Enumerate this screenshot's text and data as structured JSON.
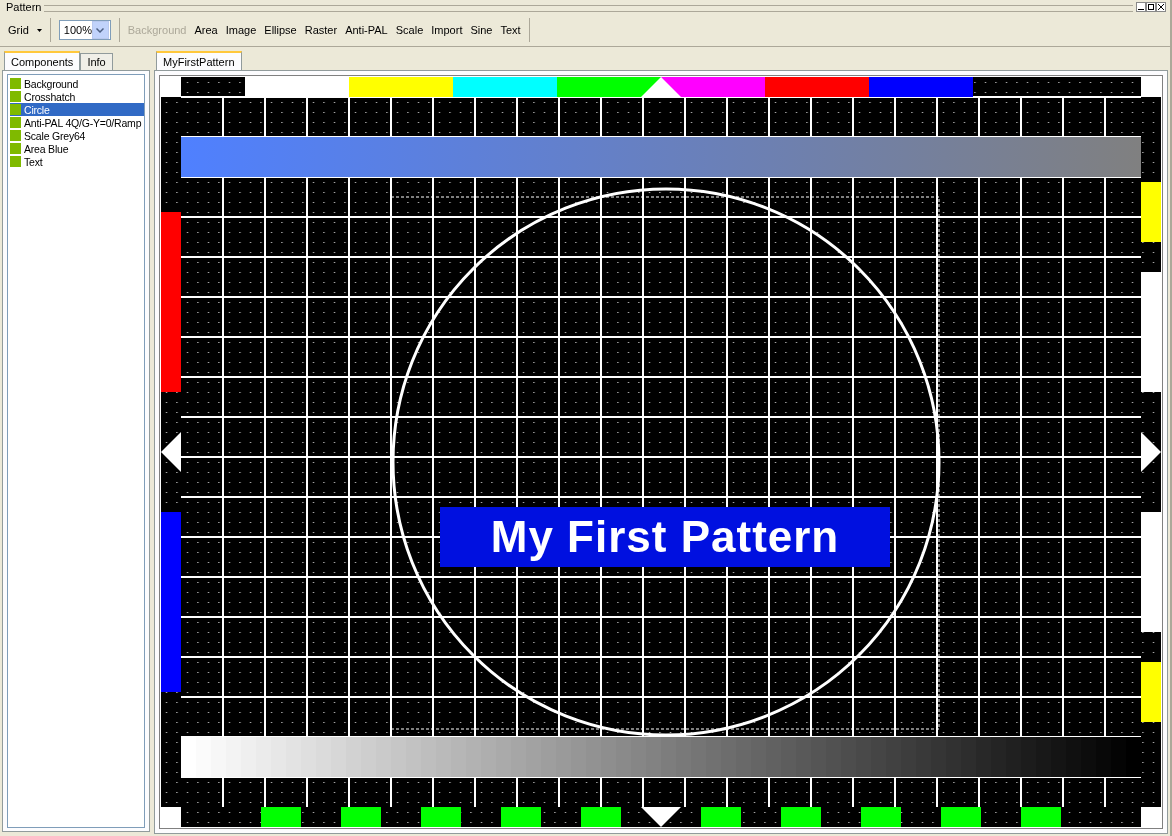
{
  "window": {
    "title": "Pattern"
  },
  "toolbar": {
    "grid_button": "Grid",
    "zoom": "100%",
    "tools": [
      {
        "label": "Background",
        "disabled": true
      },
      {
        "label": "Area",
        "disabled": false
      },
      {
        "label": "Image",
        "disabled": false
      },
      {
        "label": "Ellipse",
        "disabled": false
      },
      {
        "label": "Raster",
        "disabled": false
      },
      {
        "label": "Anti-PAL",
        "disabled": false
      },
      {
        "label": "Scale",
        "disabled": false
      },
      {
        "label": "Import",
        "disabled": false
      },
      {
        "label": "Sine",
        "disabled": false
      },
      {
        "label": "Text",
        "disabled": false
      }
    ]
  },
  "sidebar": {
    "tabs": [
      {
        "label": "Components",
        "selected": true
      },
      {
        "label": "Info",
        "selected": false
      }
    ],
    "items": [
      {
        "label": "Background",
        "selected": false
      },
      {
        "label": "Crosshatch",
        "selected": false
      },
      {
        "label": "Circle",
        "selected": true
      },
      {
        "label": "Anti-PAL 4Q/G-Y=0/Ramp",
        "selected": false
      },
      {
        "label": "Scale Grey64",
        "selected": false
      },
      {
        "label": "Area Blue",
        "selected": false
      },
      {
        "label": "Text",
        "selected": false
      }
    ]
  },
  "document": {
    "tabs": [
      {
        "label": "MyFirstPattern",
        "selected": true
      }
    ],
    "pattern_text": "My First Pattern"
  }
}
